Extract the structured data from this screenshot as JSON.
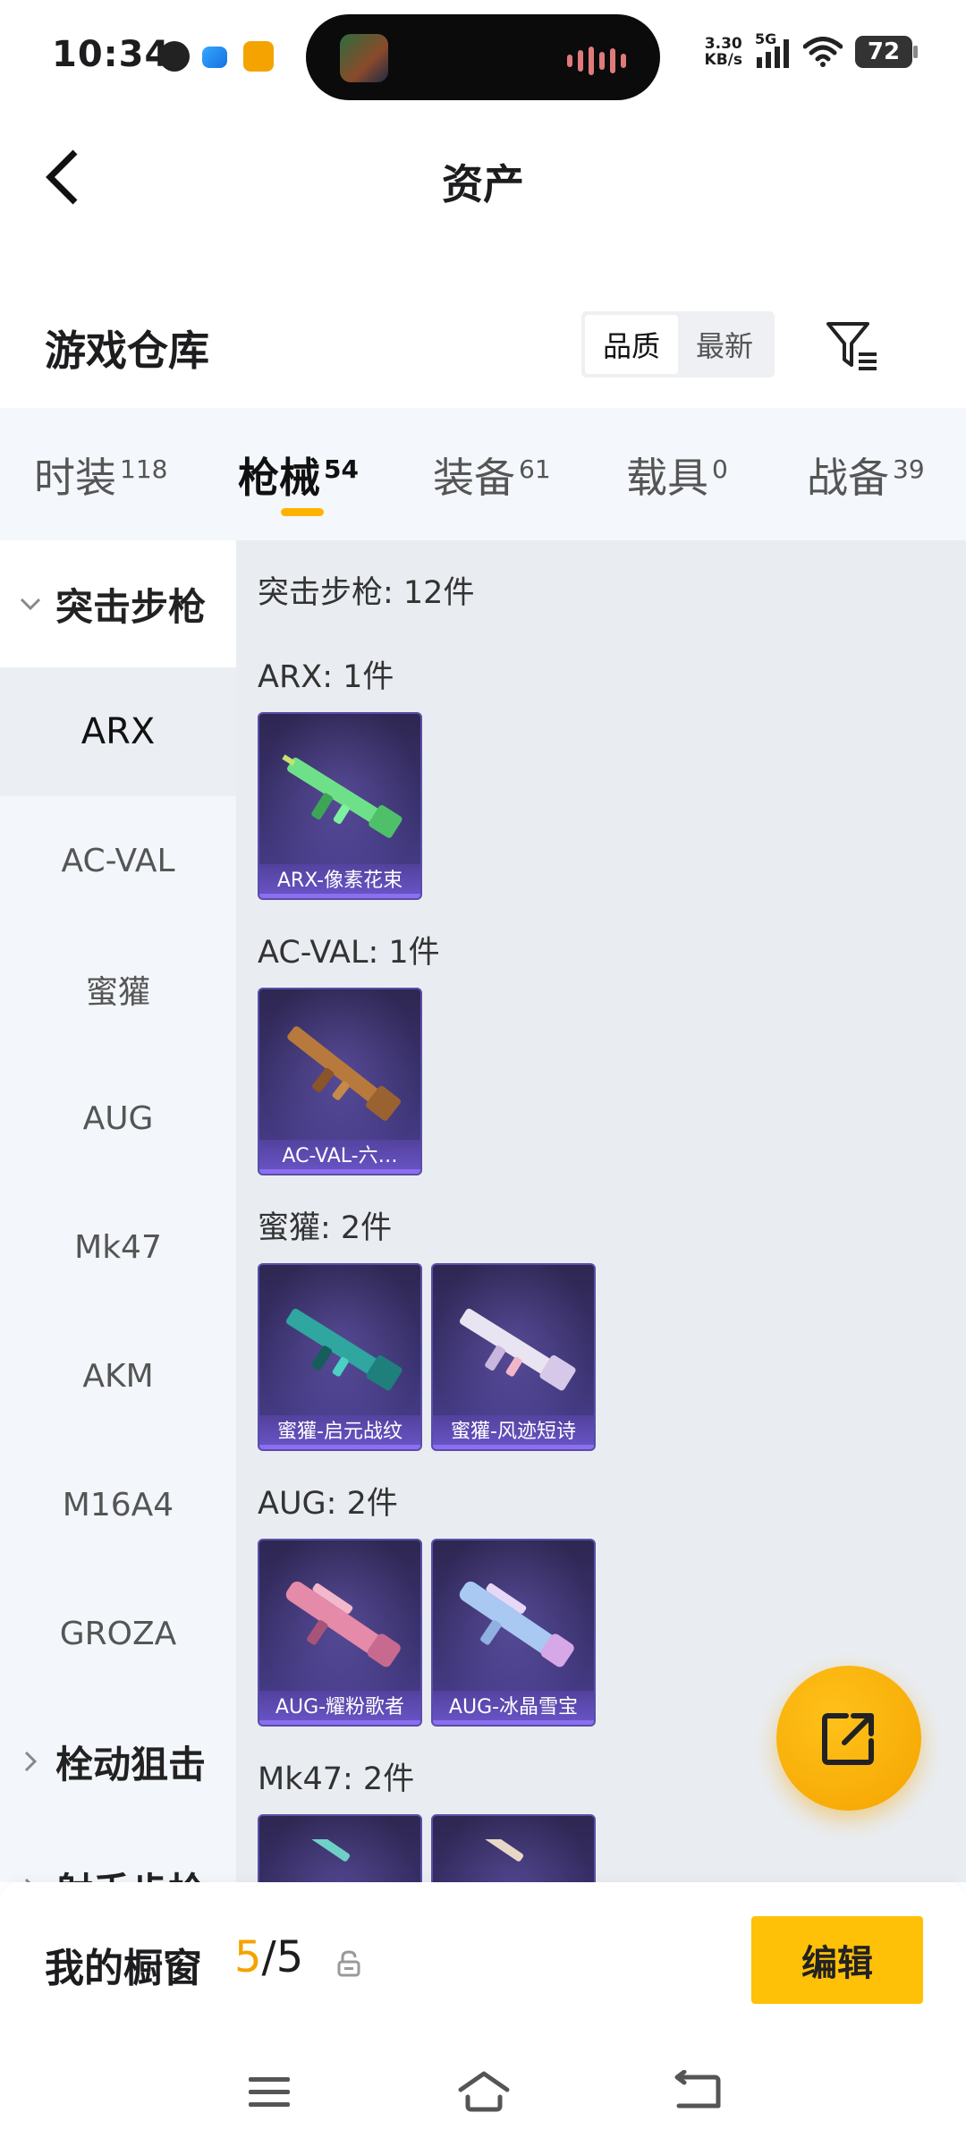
{
  "status_bar": {
    "time": "10:34",
    "net_speed_value": "3.30",
    "net_speed_unit": "KB/s",
    "network": "5G",
    "battery": "72"
  },
  "header": {
    "title": "资产",
    "back_icon": "chevron-left-icon"
  },
  "warehouse": {
    "title": "游戏仓库",
    "sort_options": [
      "品质",
      "最新"
    ],
    "sort_selected": "品质",
    "filter_icon": "filter-list-icon"
  },
  "tabs": [
    {
      "label": "时装",
      "count": "118"
    },
    {
      "label": "枪械",
      "count": "54"
    },
    {
      "label": "装备",
      "count": "61"
    },
    {
      "label": "载具",
      "count": "0"
    },
    {
      "label": "战备",
      "count": "39"
    }
  ],
  "active_tab": "枪械",
  "sidebar": {
    "categories": [
      "突击步枪",
      "栓动狙击",
      "射手步枪"
    ],
    "items": [
      "ARX",
      "AC-VAL",
      "蜜獾",
      "AUG",
      "Mk47",
      "AKM",
      "M16A4",
      "GROZA"
    ],
    "selected": "ARX"
  },
  "content": {
    "category_summary": "突击步枪: 12件",
    "groups": [
      {
        "title": "ARX: 1件",
        "skins": [
          "ARX-像素花束"
        ]
      },
      {
        "title": "AC-VAL: 1件",
        "skins": [
          "AC-VAL-六…"
        ]
      },
      {
        "title": "蜜獾: 2件",
        "skins": [
          "蜜獾-启元战纹",
          "蜜獾-风迹短诗"
        ]
      },
      {
        "title": "AUG: 2件",
        "skins": [
          "AUG-耀粉歌者",
          "AUG-冰晶雪宝"
        ]
      },
      {
        "title": "Mk47: 2件",
        "skins": [
          "",
          ""
        ]
      }
    ]
  },
  "fab": {
    "icon": "share-external-icon"
  },
  "bottom_bar": {
    "showcase_label": "我的橱窗",
    "showcase_current": "5",
    "showcase_separator": "/",
    "showcase_total": "5",
    "edit_label": "编辑"
  },
  "colors": {
    "accent": "#ffc107",
    "accent_dark": "#f5a300",
    "card_purple": "#3b3370",
    "tabs_bg": "#f4f7fb",
    "content_bg": "#e9edf2"
  }
}
